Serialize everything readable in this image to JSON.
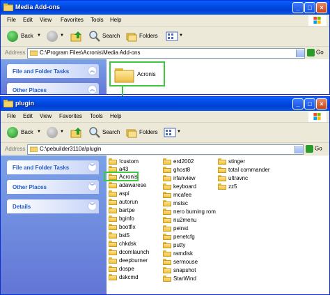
{
  "back_window": {
    "title": "Media Add-ons",
    "menu": [
      "File",
      "Edit",
      "View",
      "Favorites",
      "Tools",
      "Help"
    ],
    "toolbar": {
      "back": "Back",
      "search": "Search",
      "folders": "Folders"
    },
    "address": {
      "label": "Address",
      "path": "C:\\Program Files\\Acronis\\Media Add-ons",
      "go": "Go"
    },
    "tasks": [
      "File and Folder Tasks",
      "Other Places"
    ],
    "folder": "Acronis"
  },
  "front_window": {
    "title": "plugin",
    "menu": [
      "File",
      "Edit",
      "View",
      "Favorites",
      "Tools",
      "Help"
    ],
    "toolbar": {
      "back": "Back",
      "search": "Search",
      "folders": "Folders"
    },
    "address": {
      "label": "Address",
      "path": "C:\\pebuilder3110a\\plugin",
      "go": "Go"
    },
    "tasks": [
      "File and Folder Tasks",
      "Other Places",
      "Details"
    ],
    "folders_col1": [
      "!custom",
      "a43",
      "Acronis",
      "adawarese",
      "aspi",
      "autorun",
      "bartpe",
      "bginfo",
      "bootfix",
      "bst5",
      "chkdsk",
      "dcomlaunch",
      "deepburner",
      "dospe",
      "dskcmd"
    ],
    "folders_col2": [
      "erd2002",
      "ghost8",
      "irfanview",
      "keyboard",
      "mcafee",
      "mstsc",
      "nero burning rom",
      "nu2menu",
      "peinst",
      "penetcfg",
      "putty",
      "ramdisk",
      "sermouse",
      "snapshot",
      "StarWind"
    ],
    "folders_col3": [
      "stinger",
      "total commander",
      "ultravnc",
      "zz5"
    ]
  },
  "colors": {
    "highlight": "#3DC83D",
    "titlebar": "#0A5FFF",
    "taskpane": "#7BA2E7",
    "link": "#215DC6"
  }
}
